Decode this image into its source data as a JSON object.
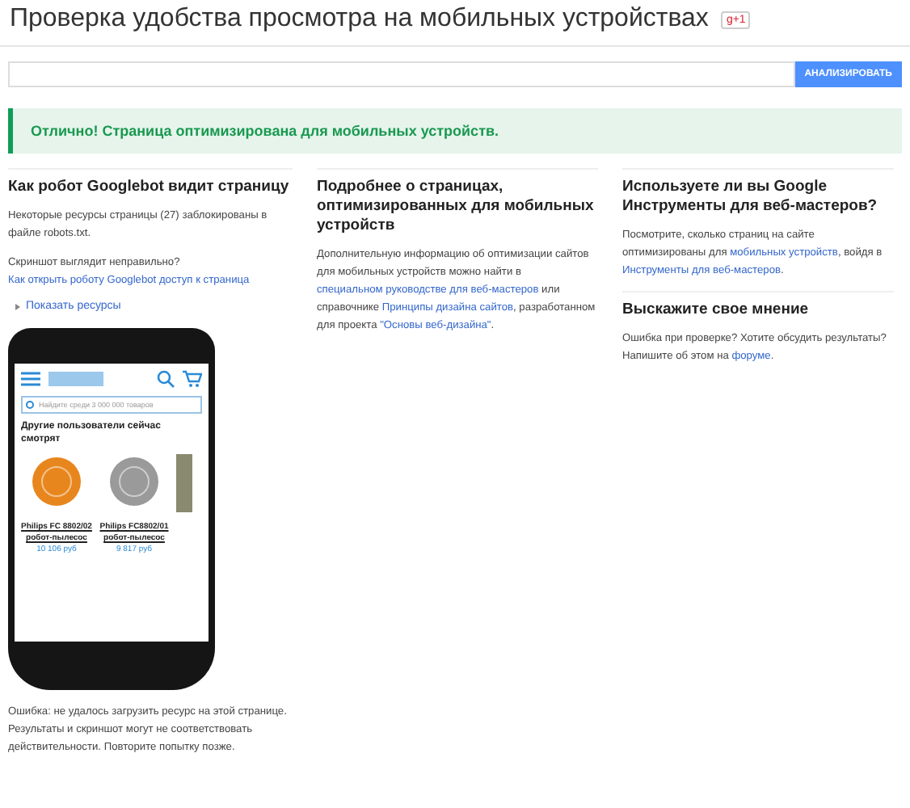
{
  "header": {
    "title": "Проверка удобства просмотра на мобильных устройствах",
    "plus_badge": "g+1"
  },
  "url_form": {
    "button": "АНАЛИЗИРОВАТЬ"
  },
  "result_banner": {
    "text": "Отлично! Страница оптимизирована для мобильных устройств."
  },
  "columns": [
    {
      "title": "Как робот Googlebot видит страницу",
      "paragraphs": [
        [
          {
            "kind": "text",
            "text": "Некоторые ресурсы страницы (27) заблокированы в файле robots.txt."
          }
        ],
        [
          {
            "kind": "text",
            "text": "Скриншот выглядит неправильно? "
          },
          {
            "kind": "link",
            "text": "Как открыть роботу Googlebot доступ к страница"
          }
        ]
      ],
      "toggle": {
        "label": "Показать ресурсы",
        "expanded": false
      }
    },
    {
      "title": "Подробнее о страницах, оптимизированных для мобильных устройств",
      "paragraphs": [
        [
          {
            "kind": "text",
            "text": "Дополнительную информацию об оптимизации сайтов для мобильных устройств можно найти в "
          },
          {
            "kind": "link",
            "text": "специальном руководстве для веб-мастеров"
          },
          {
            "kind": "text",
            "text": " или справочнике "
          },
          {
            "kind": "link",
            "text": "Принципы дизайна сайтов"
          },
          {
            "kind": "text",
            "text": ", разработанном для проекта "
          },
          {
            "kind": "link",
            "text": "\"Основы веб-дизайна\""
          },
          {
            "kind": "text",
            "text": "."
          }
        ]
      ]
    },
    {
      "title": "Используете ли вы Google Инструменты для веб-мастеров?",
      "paragraphs": [
        [
          {
            "kind": "text",
            "text": "Посмотрите, сколько страниц на сайте оптимизированы для "
          },
          {
            "kind": "link",
            "text": "мобильных устройств"
          },
          {
            "kind": "text",
            "text": ", войдя в "
          },
          {
            "kind": "link",
            "text": "Инструменты для веб-мастеров"
          },
          {
            "kind": "text",
            "text": "."
          }
        ]
      ]
    },
    {
      "title": "Выскажите свое мнение",
      "paragraphs": [
        [
          {
            "kind": "text",
            "text": "Ошибка при проверке? Хотите обсудить результаты? Напишите об этом на "
          },
          {
            "kind": "link",
            "text": "форуме"
          },
          {
            "kind": "text",
            "text": "."
          }
        ]
      ]
    }
  ],
  "phone_preview": {
    "search_placeholder": "Найдите среди 3 000 000 товаров",
    "section_title": "Другие пользователи сейчас смотрят",
    "products": [
      {
        "name": "Philips FC 8802/02 робот-пылесос",
        "price": "10 106 руб",
        "color": "#e8861e"
      },
      {
        "name": "Philips FC8802/01 робот-пылесос",
        "price": "9 817 руб",
        "color": "#9a9a9a"
      }
    ]
  },
  "error_text": "Ошибка: не удалось загрузить ресурс на этой странице. Результаты и скриншот могут не соответствовать действительности. Повторите попытку позже."
}
